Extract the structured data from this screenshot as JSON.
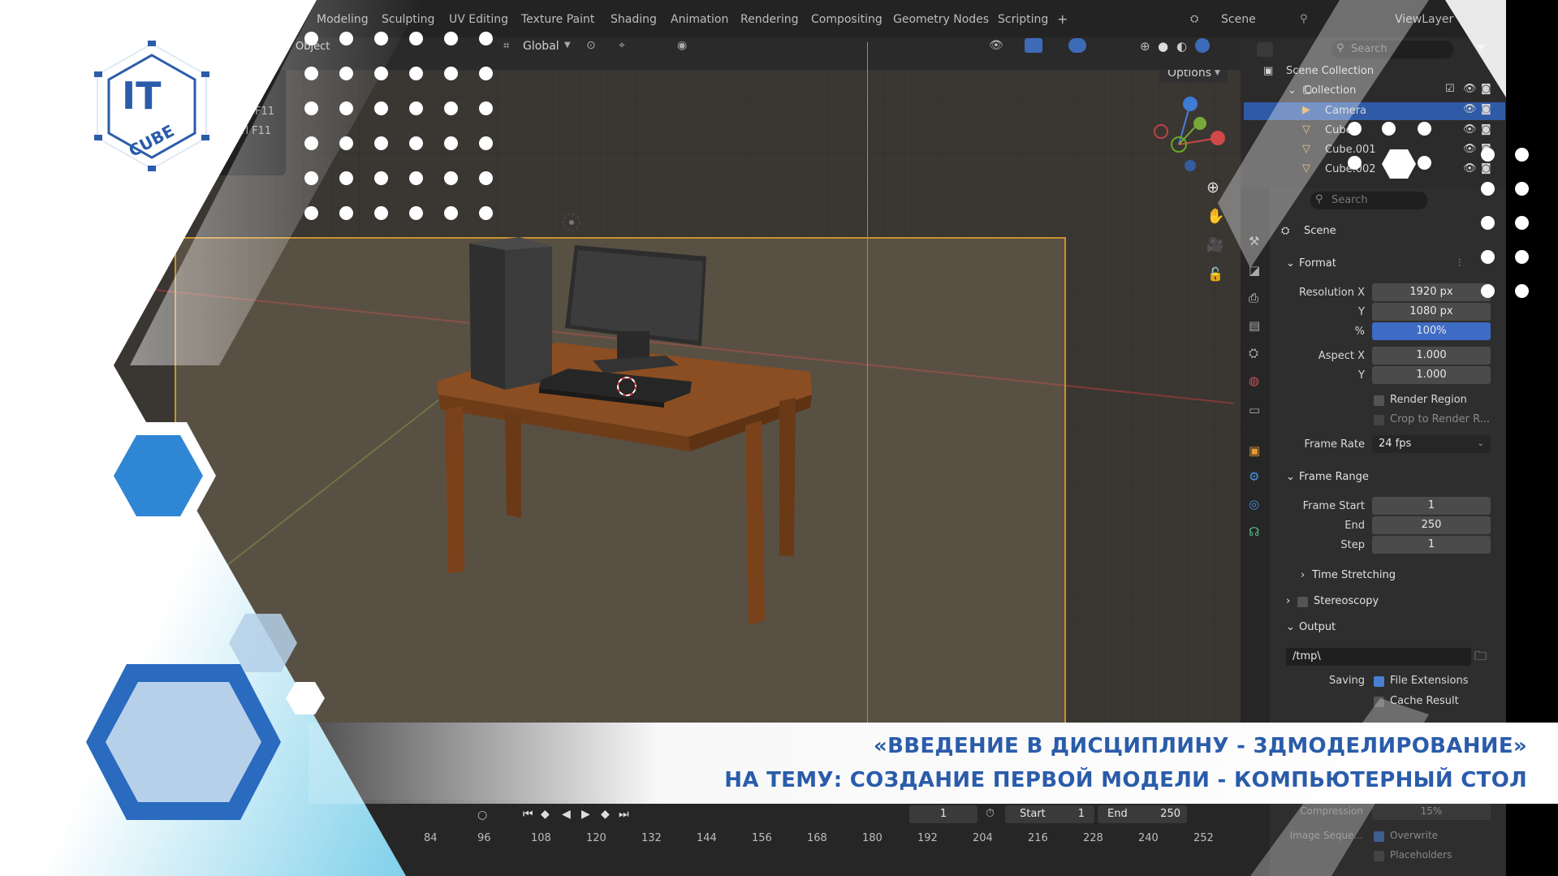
{
  "topbar": {
    "tabs": [
      "Modeling",
      "Sculpting",
      "UV Editing",
      "Texture Paint",
      "Shading",
      "Animation",
      "Rendering",
      "Compositing",
      "Geometry Nodes",
      "Scripting"
    ],
    "add_tab": "+",
    "scene_label": "Scene",
    "viewlayer_label": "ViewLayer"
  },
  "viewport_header": {
    "object_menu": "Object",
    "transform_orientation": "Global",
    "options_label": "Options"
  },
  "side_menu": {
    "shortcut_1": "F11",
    "shortcut_2": "trl F11"
  },
  "outliner": {
    "search_placeholder": "Search",
    "root": "Scene Collection",
    "collection": "Collection",
    "items": [
      "Camera",
      "Cube",
      "Cube.001",
      "Cube.002"
    ]
  },
  "properties": {
    "search_placeholder": "Search",
    "context": "Scene",
    "format": {
      "title": "Format",
      "resolution_x_label": "Resolution X",
      "resolution_x": "1920 px",
      "resolution_y_label": "Y",
      "resolution_y": "1080 px",
      "percent_label": "%",
      "percent": "100%",
      "aspect_x_label": "Aspect X",
      "aspect_x": "1.000",
      "aspect_y_label": "Y",
      "aspect_y": "1.000",
      "render_region": "Render Region",
      "crop": "Crop to Render R...",
      "frame_rate_label": "Frame Rate",
      "frame_rate": "24 fps"
    },
    "frame_range": {
      "title": "Frame Range",
      "start_label": "Frame Start",
      "start": "1",
      "end_label": "End",
      "end": "250",
      "step_label": "Step",
      "step": "1",
      "time_stretching": "Time Stretching"
    },
    "stereoscopy": "Stereoscopy",
    "output": {
      "title": "Output",
      "path": "/tmp\\",
      "saving_label": "Saving",
      "file_extensions": "File Extensions",
      "cache_result": "Cache Result",
      "compression_label": "Compression",
      "compression": "15%",
      "image_sequence_label": "Image Seque...",
      "overwrite": "Overwrite",
      "placeholders": "Placeholders"
    }
  },
  "timeline": {
    "current_frame": "1",
    "start_label": "Start",
    "start": "1",
    "end_label": "End",
    "end": "250",
    "ticks": [
      "84",
      "96",
      "108",
      "120",
      "132",
      "144",
      "156",
      "168",
      "180",
      "192",
      "204",
      "216",
      "228",
      "240",
      "252"
    ]
  },
  "logo": {
    "letters": "IT",
    "word": "CUBE"
  },
  "banner": {
    "line1": "«ВВЕДЕНИЕ В ДИСЦИПЛИНУ - 3ДМОДЕЛИРОВАНИЕ»",
    "line2": "НА ТЕМУ: СОЗДАНИЕ ПЕРВОЙ МОДЕЛИ - КОМПЬЮТЕРНЫЙ СТОЛ"
  },
  "colors": {
    "brand_blue": "#2a5caa",
    "light_blue": "#3fa3e0",
    "camera_frame": "#c9922e",
    "table_wood": "#8b4e22",
    "selection": "#2f5aa6"
  }
}
